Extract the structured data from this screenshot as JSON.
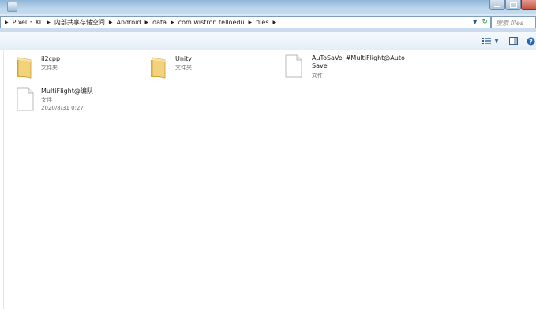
{
  "breadcrumb": [
    "Pixel 3 XL",
    "内部共享存储空间",
    "Android",
    "data",
    "com.wistron.telloedu",
    "files"
  ],
  "search": {
    "placeholder": "搜索 files"
  },
  "items": [
    {
      "name": "il2cpp",
      "type": "文件夹",
      "icon": "folder-icon"
    },
    {
      "name": "Unity",
      "type": "文件夹",
      "icon": "folder-icon"
    },
    {
      "name_line1": "AuToSaVe_#MultiFlight@Auto",
      "name_line2": "Save",
      "type": "文件",
      "icon": "file-icon"
    },
    {
      "name": "MultiFlight@编队",
      "type": "文件",
      "date": "2020/8/31 0:27",
      "icon": "file-icon"
    }
  ],
  "colors": {
    "accent": "#2a5590",
    "folder": "#e8c25a",
    "titlebar": "#bcd6ec"
  }
}
